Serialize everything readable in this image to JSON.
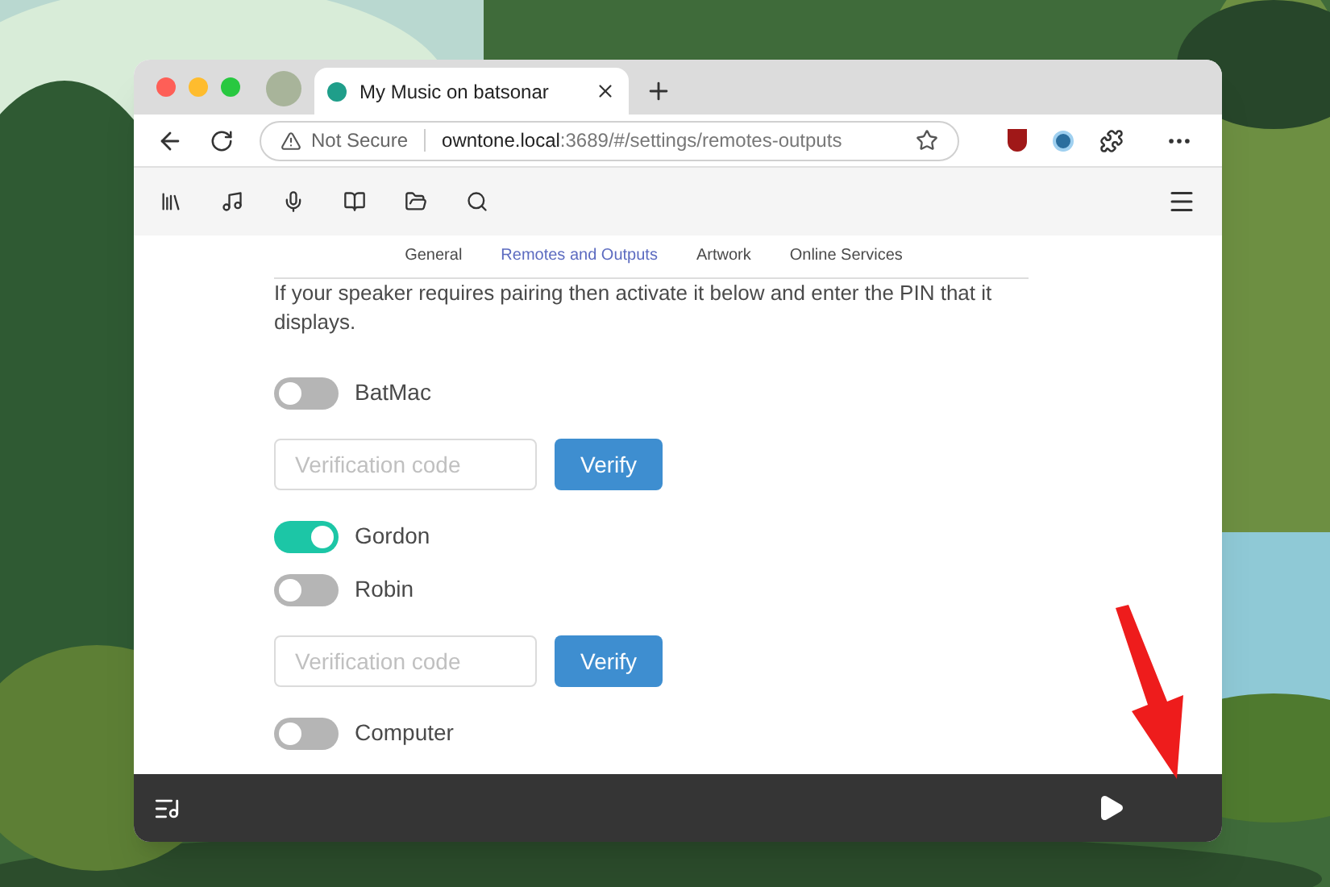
{
  "browser": {
    "tab_title": "My Music on batsonar",
    "security": "Not Secure",
    "host": "owntone.local",
    "path": ":3689/#/settings/remotes-outputs"
  },
  "settings_tabs": [
    {
      "label": "General",
      "selected": false
    },
    {
      "label": "Remotes and Outputs",
      "selected": true
    },
    {
      "label": "Artwork",
      "selected": false
    },
    {
      "label": "Online Services",
      "selected": false
    }
  ],
  "intro": "If your speaker requires pairing then activate it below and enter the PIN that it displays.",
  "outputs": [
    {
      "kind": "toggle",
      "label": "BatMac",
      "on": false
    },
    {
      "kind": "verification",
      "placeholder": "Verification code",
      "button": "Verify"
    },
    {
      "kind": "toggle",
      "label": "Gordon",
      "on": true
    },
    {
      "kind": "toggle",
      "label": "Robin",
      "on": false
    },
    {
      "kind": "verification",
      "placeholder": "Verification code",
      "button": "Verify"
    },
    {
      "kind": "toggle",
      "label": "Computer",
      "on": false
    }
  ]
}
